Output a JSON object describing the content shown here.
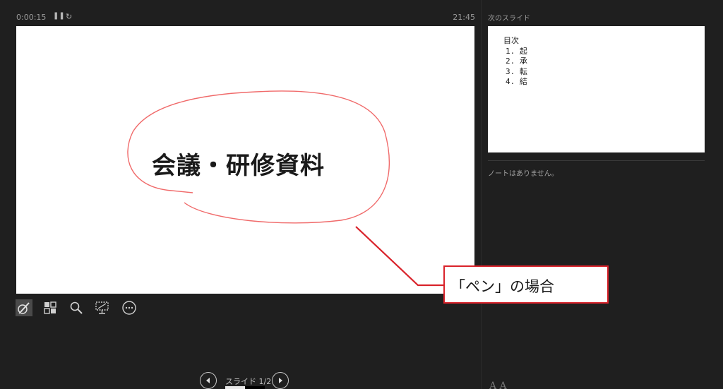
{
  "header": {
    "timer": "0:00:15",
    "clock": "21:45",
    "pause_icon": "pause-icon",
    "reset_icon": "reset-icon"
  },
  "current_slide": {
    "title": "会議・研修資料",
    "ink_color": "#f06a6a"
  },
  "tools": [
    {
      "name": "pen-icon",
      "active": true
    },
    {
      "name": "slides-grid-icon",
      "active": false
    },
    {
      "name": "zoom-icon",
      "active": false
    },
    {
      "name": "screen-icon",
      "active": false
    },
    {
      "name": "more-icon",
      "active": false
    }
  ],
  "next_slide_panel": {
    "label": "次のスライド",
    "preview": {
      "heading": "目次",
      "items": [
        "1. 起",
        "2. 承",
        "3. 転",
        "4. 結"
      ]
    },
    "notes": "ノートはありません。",
    "font_size_icon": "A A"
  },
  "callout": {
    "text": "「ペン」の場合",
    "color": "#d9232b"
  },
  "navigation": {
    "label": "スライド",
    "position": "1/2",
    "progress": 0.5,
    "prev_icon": "prev-arrow-icon",
    "next_icon": "next-arrow-icon"
  }
}
